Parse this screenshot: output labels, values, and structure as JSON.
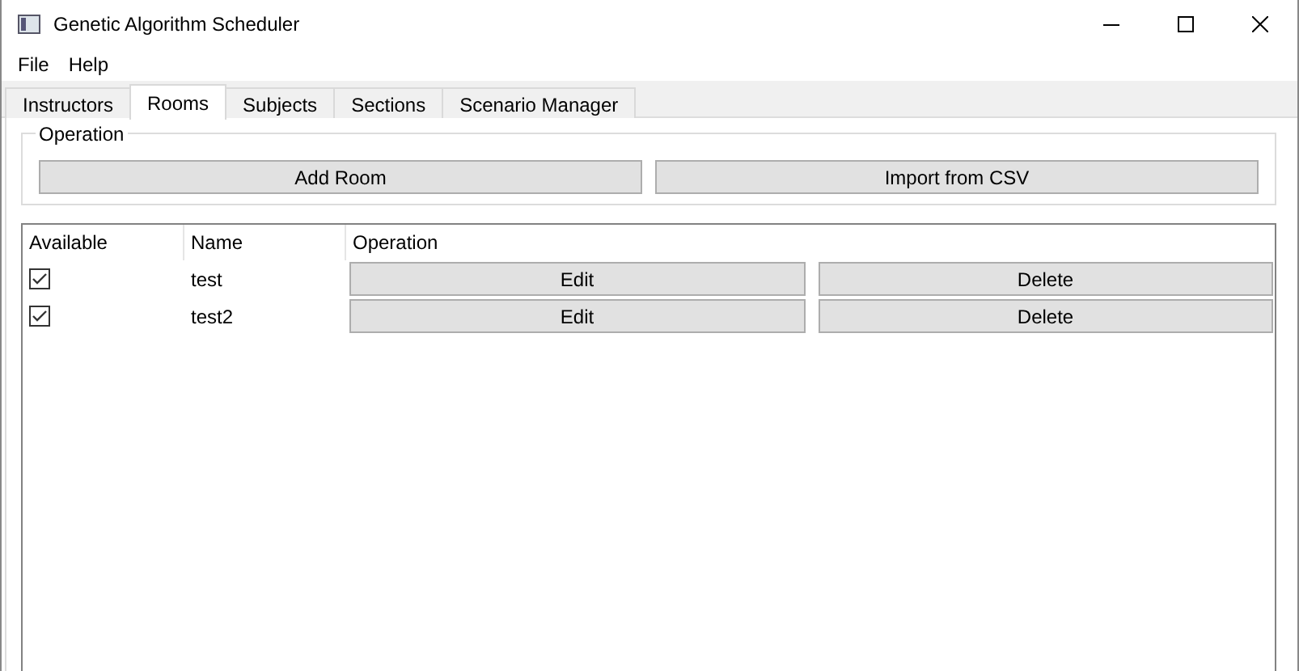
{
  "window": {
    "title": "Genetic Algorithm Scheduler"
  },
  "menu": [
    "File",
    "Help"
  ],
  "tabs": [
    {
      "label": "Instructors",
      "selected": false
    },
    {
      "label": "Rooms",
      "selected": true
    },
    {
      "label": "Subjects",
      "selected": false
    },
    {
      "label": "Sections",
      "selected": false
    },
    {
      "label": "Scenario Manager",
      "selected": false
    }
  ],
  "operation_group": {
    "title": "Operation",
    "buttons": [
      "Add Room",
      "Import from CSV"
    ]
  },
  "table": {
    "columns": [
      "Available",
      "Name",
      "Operation"
    ],
    "rows": [
      {
        "available": true,
        "name": "test",
        "buttons": [
          "Edit",
          "Delete"
        ]
      },
      {
        "available": true,
        "name": "test2",
        "buttons": [
          "Edit",
          "Delete"
        ]
      }
    ]
  }
}
